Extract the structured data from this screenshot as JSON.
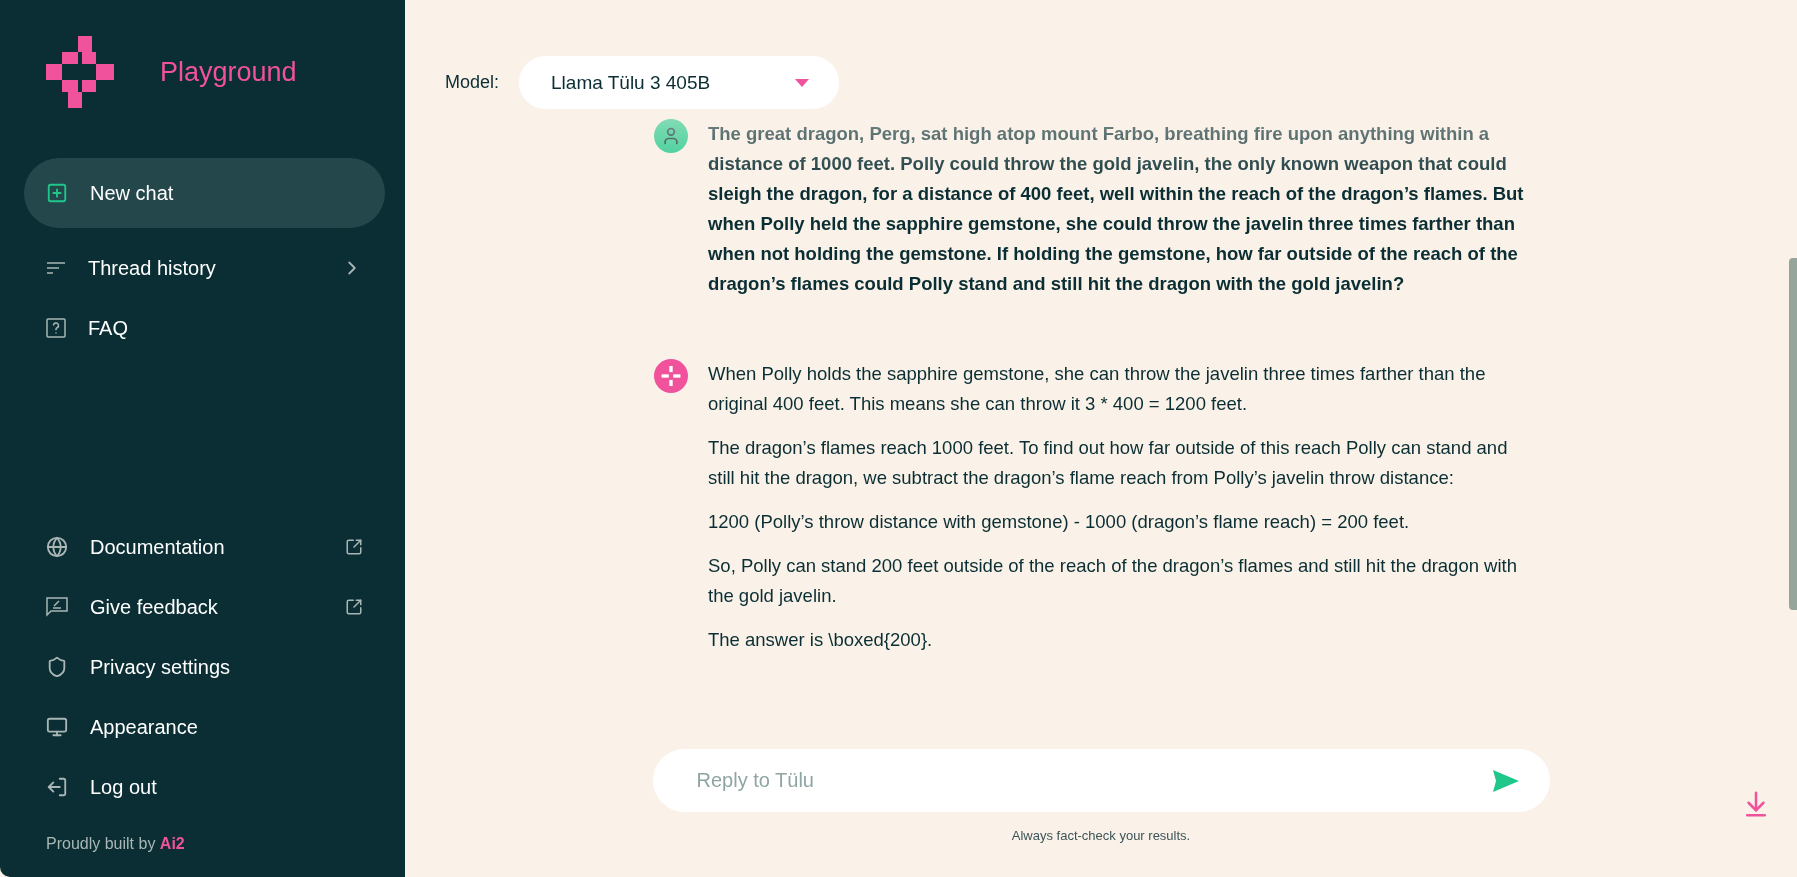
{
  "brand": {
    "name": "Playground"
  },
  "sidebar": {
    "items": [
      {
        "label": "New chat",
        "kind": "new",
        "selected": true
      },
      {
        "label": "Thread history",
        "kind": "expand",
        "selected": false
      },
      {
        "label": "FAQ",
        "kind": "plain",
        "selected": false
      }
    ],
    "bottom_items": [
      {
        "label": "Documentation",
        "external": true
      },
      {
        "label": "Give feedback",
        "external": true
      },
      {
        "label": "Privacy settings",
        "external": false
      },
      {
        "label": "Appearance",
        "external": false
      },
      {
        "label": "Log out",
        "external": false
      }
    ],
    "footer": {
      "text": "Proudly built by",
      "link": "Ai2"
    }
  },
  "model": {
    "label": "Model:",
    "value": "Llama Tülu 3 405B"
  },
  "messages": [
    {
      "kind": "user",
      "paragraphs": [
        "The great dragon, Perg, sat high atop mount Farbo, breathing fire upon anything within a distance of 1000 feet. Polly could throw the gold javelin, the only known weapon that could sleigh the dragon, for a distance of 400 feet, well within the reach of the dragon’s flames. But when Polly held the sapphire gemstone, she could throw the javelin three times farther than when not holding the gemstone. If holding the gemstone, how far outside of the reach of the dragon’s flames could Polly stand and still hit the dragon with the gold javelin?"
      ]
    },
    {
      "kind": "assistant",
      "paragraphs": [
        "When Polly holds the sapphire gemstone, she can throw the javelin three times farther than the original 400 feet. This means she can throw it 3 * 400 = 1200 feet.",
        "The dragon’s flames reach 1000 feet. To find out how far outside of this reach Polly can stand and still hit the dragon, we subtract the dragon’s flame reach from Polly’s javelin throw distance:",
        "1200 (Polly’s throw distance with gemstone) - 1000 (dragon’s flame reach) = 200 feet.",
        "So, Polly can stand 200 feet outside of the reach of the dragon’s flames and still hit the dragon with the gold javelin.",
        "The answer is \\boxed{200}."
      ]
    }
  ],
  "composer": {
    "placeholder": "Reply to Tülu"
  },
  "disclaimer": "Always fact-check your results."
}
